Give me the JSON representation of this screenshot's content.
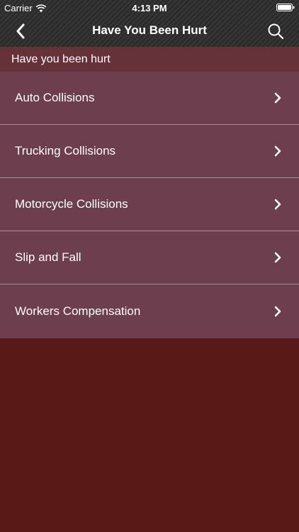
{
  "status_bar": {
    "carrier": "Carrier",
    "time": "4:13 PM",
    "icons": [
      "wifi-icon",
      "battery-icon"
    ]
  },
  "nav": {
    "title": "Have You Been Hurt",
    "back_icon": "chevron-left-icon",
    "search_icon": "search-icon"
  },
  "section": {
    "heading": "Have you been hurt"
  },
  "menu": {
    "items": [
      {
        "label": "Auto Collisions",
        "icon": "chevron-right-icon"
      },
      {
        "label": "Trucking Collisions",
        "icon": "chevron-right-icon"
      },
      {
        "label": "Motorcycle Collisions",
        "icon": "chevron-right-icon"
      },
      {
        "label": "Slip and Fall",
        "icon": "chevron-right-icon"
      },
      {
        "label": "Workers Compensation",
        "icon": "chevron-right-icon"
      }
    ]
  },
  "colors": {
    "header_bg": "#2b2b2b",
    "section_bg": "#663239",
    "row_bg": "#6d3e4e",
    "row_divider": "#a6909a",
    "page_bg": "#591916",
    "text": "#ffffff"
  }
}
